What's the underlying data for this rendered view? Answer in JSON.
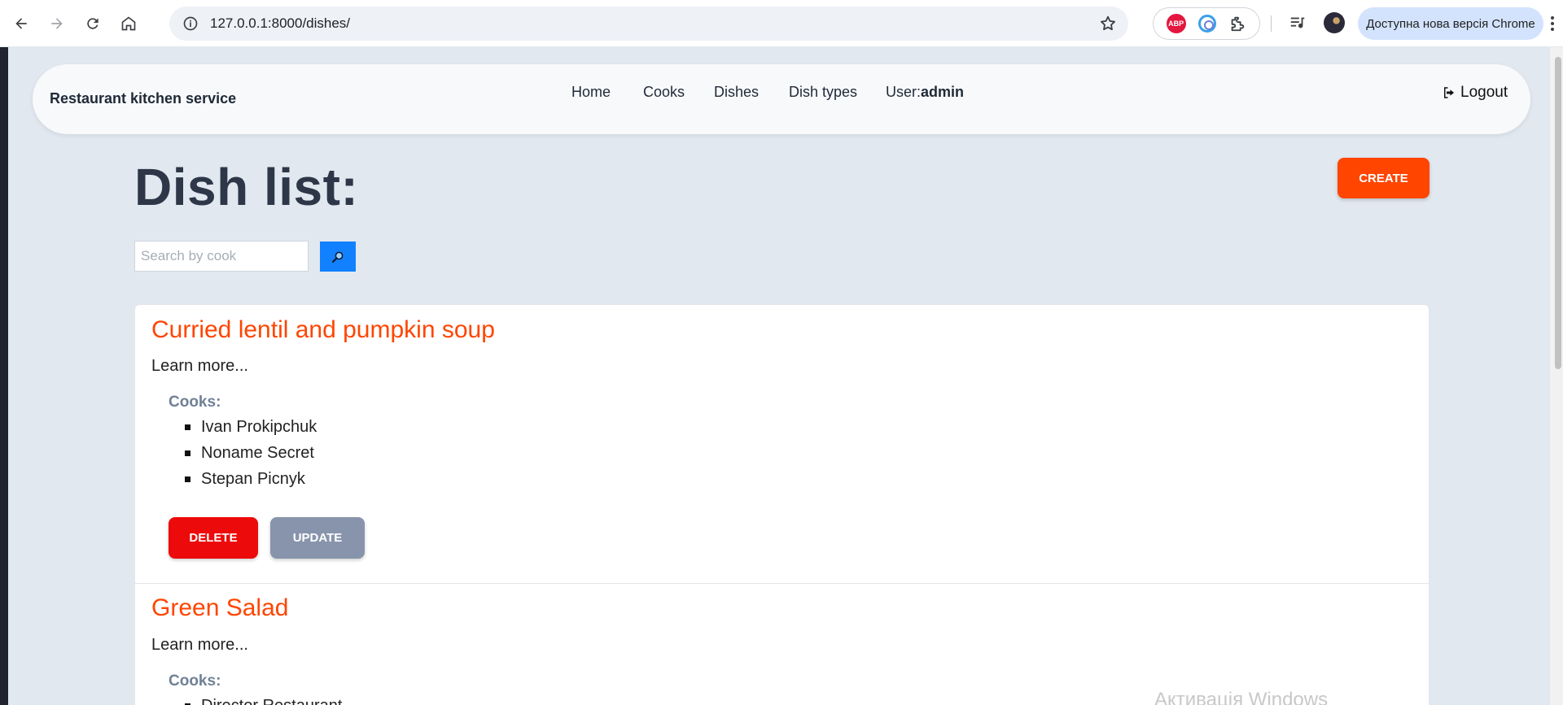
{
  "browser": {
    "url": "127.0.0.1:8000/dishes/",
    "update_pill": "Доступна нова версія Chrome",
    "extensions": {
      "abp_label": "ABP"
    }
  },
  "site": {
    "brand": "Restaurant kitchen service",
    "nav": {
      "home": "Home",
      "cooks": "Cooks",
      "dishes": "Dishes",
      "dish_types": "Dish types",
      "user_label": "User:",
      "user_name": "admin",
      "logout": "Logout"
    }
  },
  "main": {
    "title": "Dish list:",
    "create_label": "CREATE",
    "search_placeholder": "Search by cook",
    "dishes": [
      {
        "name": "Curried lentil and pumpkin soup",
        "learn_more": "Learn more...",
        "cooks_label": "Cooks:",
        "cooks": [
          "Ivan Prokipchuk",
          "Noname Secret",
          "Stepan Picnyk"
        ],
        "delete_label": "DELETE",
        "update_label": "UPDATE"
      },
      {
        "name": "Green Salad",
        "learn_more": "Learn more...",
        "cooks_label": "Cooks:",
        "cooks": [
          "Director Restaurant"
        ]
      }
    ]
  },
  "overlay": {
    "watermark": "Активація Windows"
  },
  "colors": {
    "accent": "#ff4500",
    "delete": "#ed0a0a",
    "update": "#8794ac",
    "search": "#1181ff",
    "page_bg": "#e2e8f0"
  }
}
